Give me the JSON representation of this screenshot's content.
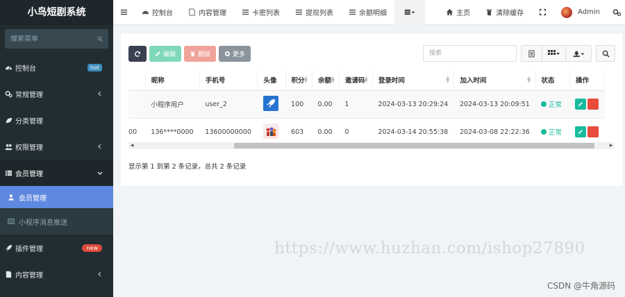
{
  "app": {
    "title": "小鸟短剧系统"
  },
  "sidebar": {
    "search_placeholder": "搜索菜单",
    "items": [
      {
        "label": "控制台",
        "badge": "hot"
      },
      {
        "label": "常规管理"
      },
      {
        "label": "分类管理"
      },
      {
        "label": "权限管理"
      },
      {
        "label": "会员管理"
      },
      {
        "label": "插件管理",
        "badge": "new"
      },
      {
        "label": "内容管理"
      }
    ],
    "submenu": [
      {
        "label": "会员管理"
      },
      {
        "label": "小程序消息推送"
      }
    ]
  },
  "topnav": {
    "tabs": [
      {
        "label": "控制台"
      },
      {
        "label": "内容管理"
      },
      {
        "label": "卡密列表"
      },
      {
        "label": "提现列表"
      },
      {
        "label": "余额明细"
      }
    ],
    "home_label": "主页",
    "clear_cache_label": "清除缓存",
    "user_label": "Admin"
  },
  "toolbar": {
    "edit_label": "编辑",
    "delete_label": "删除",
    "more_label": "更多",
    "search_placeholder": "搜索"
  },
  "table": {
    "columns": [
      "昵称",
      "手机号",
      "头像",
      "积分",
      "余额",
      "邀请码",
      "登录时间",
      "加入时间",
      "状态",
      "操作"
    ],
    "rows": [
      {
        "partial": "",
        "nickname": "小程序用户",
        "phone": "user_2",
        "points": "100",
        "balance": "0.00",
        "invite": "1",
        "login_time": "2024-03-13 20:29:24",
        "join_time": "2024-03-13 20:09:51",
        "status": "正常"
      },
      {
        "partial": "000",
        "nickname": "136****0000",
        "phone": "13600000000",
        "points": "603",
        "balance": "0.00",
        "invite": "0",
        "login_time": "2024-03-14 20:55:38",
        "join_time": "2024-03-08 22:22:36",
        "status": "正常"
      }
    ]
  },
  "pager": {
    "info": "显示第 1 到第 2 条记录，总共 2 条记录"
  },
  "watermark": {
    "text": "https://www.huzhan.com/ishop27890"
  },
  "footer": {
    "csdn": "CSDN @牛角源码"
  },
  "colors": {
    "sidebar_bg": "#222d32",
    "active": "#5f88e0",
    "success": "#18bc9c",
    "danger": "#e74c3c"
  }
}
